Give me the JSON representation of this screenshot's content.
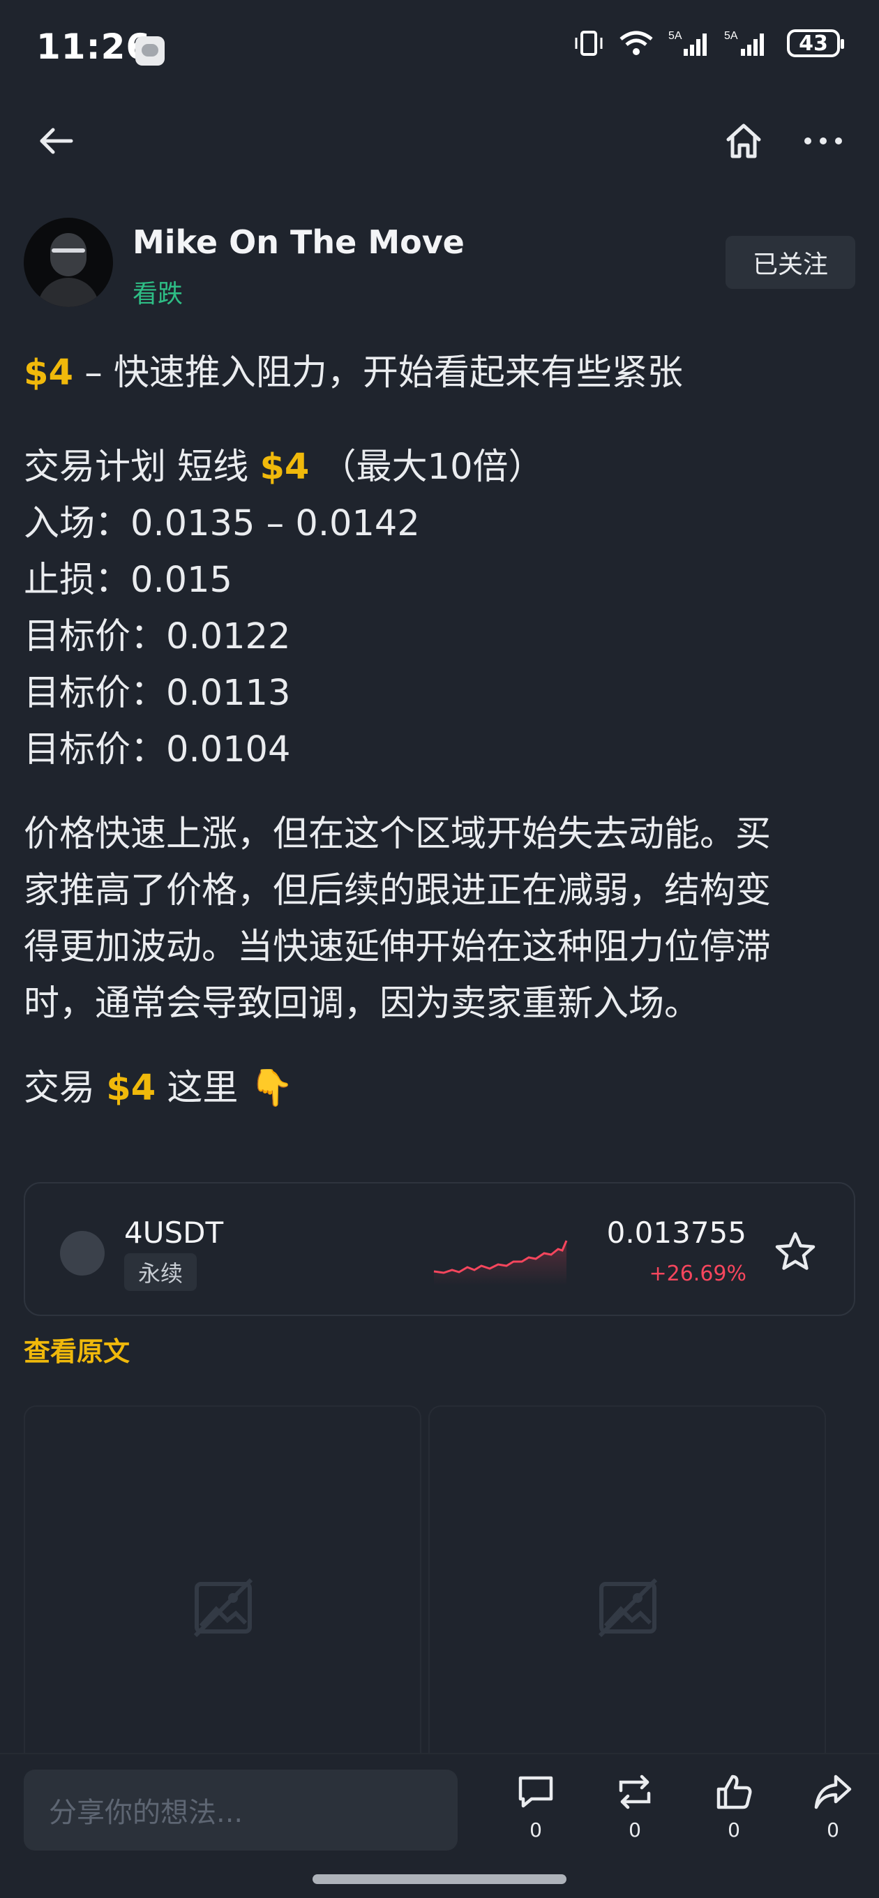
{
  "status_bar": {
    "time": "11:26",
    "battery": "43",
    "network_1": "5A",
    "network_2": "5A"
  },
  "post": {
    "author_name": "Mike On The Move",
    "author_tag": "看跌",
    "follow_label": "已关注",
    "title_cashtag": "$4",
    "title_text": " – 快速推入阻力，开始看起来有些紧张",
    "plan_prefix": "交易计划 短线 ",
    "plan_cashtag": "$4",
    "plan_suffix": " （最大10倍）",
    "entry": "入场：0.0135 – 0.0142",
    "stop_loss": "止损：0.015",
    "target_1": "目标价：0.0122",
    "target_2": "目标价：0.0113",
    "target_3": "目标价：0.0104",
    "analysis_1": "价格快速上涨，但在这个区域开始失去动能。买",
    "analysis_2": "家推高了价格，但后续的跟进正在减弱，结构变",
    "analysis_3": "得更加波动。当快速延伸开始在这种阻力位停滞",
    "analysis_4": "时，通常会导致回调，因为卖家重新入场。",
    "trade_prefix": "交易 ",
    "trade_cashtag": "$4",
    "trade_suffix": " 这里 👇",
    "view_original": "查看原文"
  },
  "market_card": {
    "pair": "4USDT",
    "badge": "永续",
    "price": "0.013755",
    "change": "+26.69%"
  },
  "bottom_bar": {
    "comment_placeholder": "分享你的想法...",
    "comment_count": "0",
    "repost_count": "0",
    "like_count": "0",
    "share_count": "0"
  },
  "colors": {
    "accent": "#f0b90b",
    "bearish_tag": "#2ebd85",
    "negative_change": "#f6465d",
    "background": "#1f242d"
  },
  "icons": [
    "back-arrow-icon",
    "home-icon",
    "more-icon",
    "star-icon",
    "image-placeholder-icon",
    "comment-icon",
    "repost-icon",
    "like-icon",
    "share-icon"
  ]
}
